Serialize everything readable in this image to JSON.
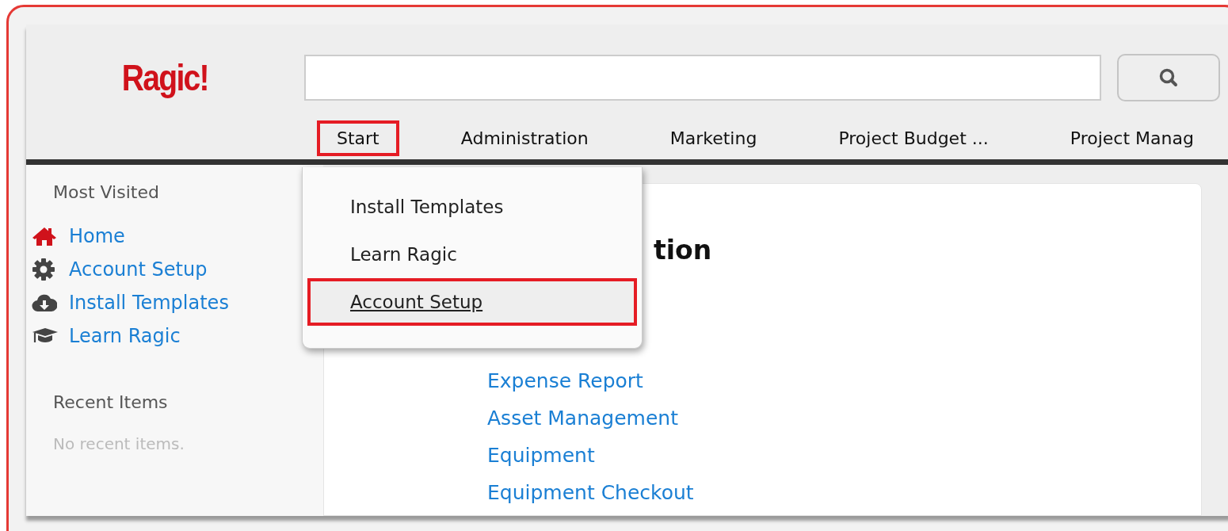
{
  "logo": "Ragic!",
  "tabs": [
    {
      "label": "Start",
      "highlighted": true
    },
    {
      "label": "Administration",
      "highlighted": false
    },
    {
      "label": "Marketing",
      "highlighted": false
    },
    {
      "label": "Project Budget ...",
      "highlighted": false
    },
    {
      "label": "Project Manag",
      "highlighted": false
    }
  ],
  "dropdown": {
    "items": [
      {
        "label": "Install Templates",
        "highlighted": false
      },
      {
        "label": "Learn Ragic",
        "highlighted": false
      },
      {
        "label": "Account Setup",
        "highlighted": true
      }
    ]
  },
  "sidebar": {
    "most_visited_title": "Most Visited",
    "links": [
      {
        "label": "Home",
        "kind": "home"
      },
      {
        "label": "Account Setup",
        "kind": "gear"
      },
      {
        "label": "Install Templates",
        "kind": "cloud"
      },
      {
        "label": "Learn Ragic",
        "kind": "cap"
      }
    ],
    "recent_title": "Recent Items",
    "recent_empty": "No recent items."
  },
  "content": {
    "heading": "tion",
    "links": [
      "Expense Report",
      "Asset Management",
      "Equipment",
      "Equipment Checkout"
    ]
  }
}
